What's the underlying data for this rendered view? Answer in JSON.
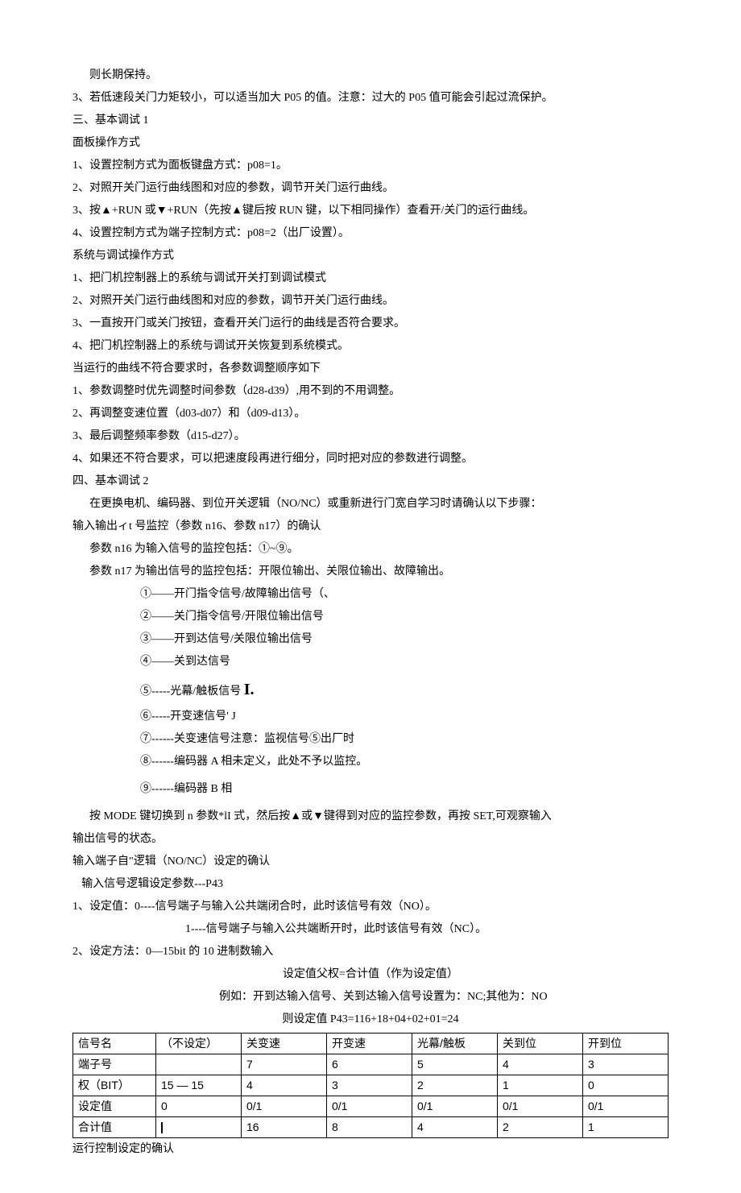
{
  "p": {
    "keep": "则长期保持。",
    "l3": "3、若低速段关门力矩较小，可以适当加大 P05 的值。注意：过大的 P05 值可能会引起过流保护。",
    "sec3": "三、基本调试 1",
    "panel": "面板操作方式",
    "p1": "1、设置控制方式为面板键盘方式：p08=1。",
    "p2": "2、对照开关门运行曲线图和对应的参数，调节开关门运行曲线。",
    "p3": "3、按▲+RUN 或▼+RUN（先按▲键后按 RUN 键，以下相同操作）查看开/关门的运行曲线。",
    "p4": "4、设置控制方式为端子控制方式：p08=2（出厂设置）。",
    "sysdbg": "系统与调试操作方式",
    "s1": "1、把门机控制器上的系统与调试开关打到调试模式",
    "s2": "2、对照开关门运行曲线图和对应的参数，调节开关门运行曲线。",
    "s3": "3、一直按开门或关门按钮，查看开关门运行的曲线是否符合要求。",
    "s4": "4、把门机控制器上的系统与调试开关恢复到系统模式。",
    "adj": "当运行的曲线不符合要求时，各参数调整顺序如下",
    "a1": "1、参数调整时优先调整时间参数（d28-d39）,用不到的不用调整。",
    "a2": "2、再调整变速位置（d03-d07）和（d09-d13）。",
    "a3": "3、最后调整频率参数（d15-d27）。",
    "a4": "4、如果还不符合要求，可以把速度段再进行细分，同时把对应的参数进行调整。",
    "sec4": "四、基本调试 2",
    "change": "在更换电机、编码器、到位开关逻辑（NO/NC）或重新进行门宽自学习时请确认以下步骤：",
    "io": "输入输出ィt 号监控（参数 n16、参数 n17）的确认",
    "n16": "参数 n16 为输入信号的监控包括：①~⑨。",
    "n17": "参数 n17 为输出信号的监控包括：开限位输出、关限位输出、故障输出。",
    "c1": "①——开门指令信号/故障输出信号（、",
    "c2": "②——关门指令信号/开限位输出信号",
    "c3": "③——开到达信号/关限位输出信号",
    "c4": "④——关到达信号",
    "c5a": "⑤-----光幕/触板信号",
    "c5b": "I.",
    "c6": "⑥-----开变速信号' J",
    "c7": "⑦------关变速信号注意：监视信号⑤出厂时",
    "c8": "⑧------编码器 A 相未定义，此处不予以监控。",
    "c9": "⑨------编码器 B 相",
    "mode": "按 MODE 键切换到 n 参数*lI 式，然后按▲或▼键得到对应的监控参数，再按 SET,可观察输入",
    "mode2": "输出信号的状态。",
    "inlogic": "输入端子自\"逻辑（NO/NC）设定的确认",
    "p43": "输入信号逻辑设定参数---P43",
    "set1": "1、设定值：0----信号端子与输入公共端闭合时，此时该信号有效（NO）。",
    "set1b": "1----信号端子与输入公共端断开时，此时该信号有效（NC）。",
    "set2": "2、设定方法：0—15bit 的 10 进制数输入",
    "formula": "设定值父权=合计值（作为设定值）",
    "example": "例如：开到达输入信号、关到达输入信号设置为：NC;其他为：NO",
    "result": "则设定值 P43=116+18+04+02+01=24",
    "runconf": "运行控制设定的确认"
  },
  "table": {
    "rows": [
      [
        "信号名",
        "（不设定）",
        "关变速",
        "开变速",
        "光幕/触板",
        "关到位",
        "开到位"
      ],
      [
        "端子号",
        "",
        "7",
        "6",
        "5",
        "4",
        "3"
      ],
      [
        "权（BIT）",
        "15 — 15",
        "4",
        "3",
        "2",
        "1",
        "0"
      ],
      [
        "设定值",
        "0",
        "0/1",
        "0/1",
        "0/1",
        "0/1",
        "0/1"
      ],
      [
        "合计值",
        "",
        "16",
        "8",
        "4",
        "2",
        "1"
      ]
    ]
  }
}
